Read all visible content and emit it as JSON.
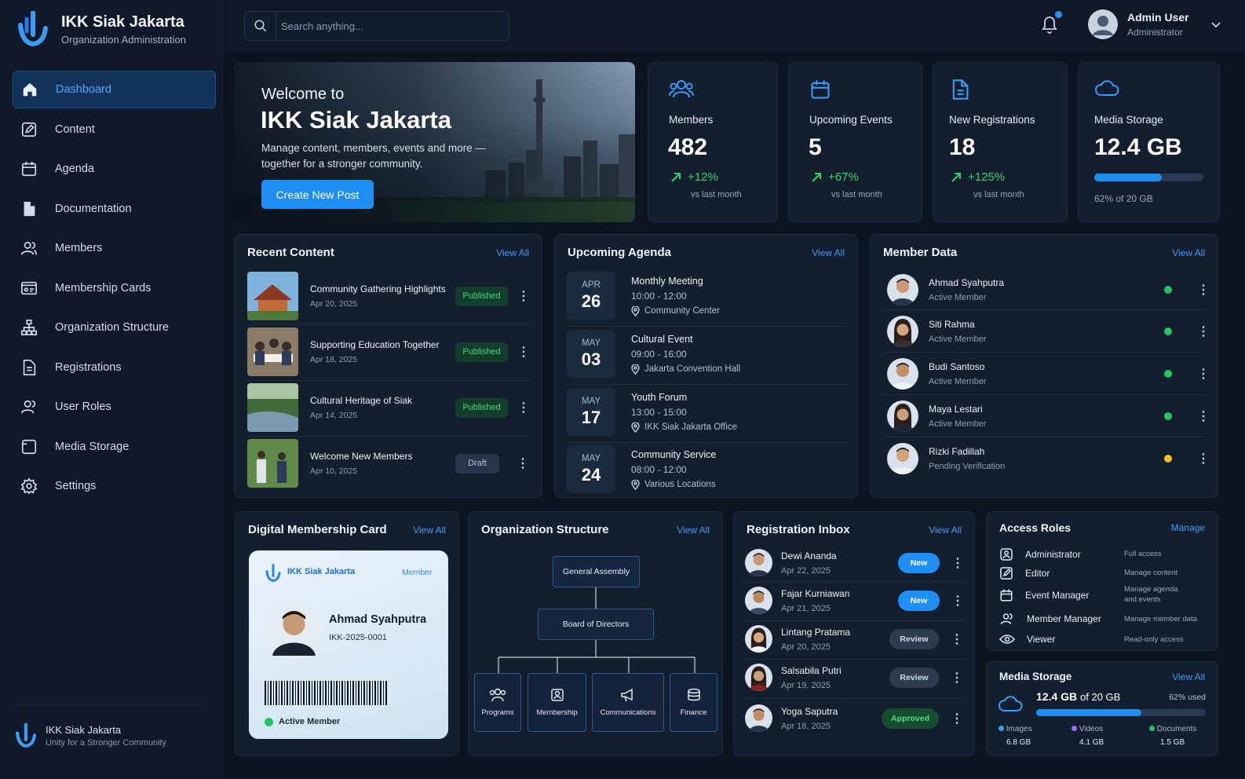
{
  "brand": {
    "name": "IKK Siak Jakarta",
    "subtitle": "Organization Administration"
  },
  "nav": [
    {
      "label": "Dashboard",
      "icon": "home-icon"
    },
    {
      "label": "Content",
      "icon": "edit-icon"
    },
    {
      "label": "Agenda",
      "icon": "calendar-icon"
    },
    {
      "label": "Documentation",
      "icon": "document-icon"
    },
    {
      "label": "Members",
      "icon": "users-icon"
    },
    {
      "label": "Membership Cards",
      "icon": "id-card-icon"
    },
    {
      "label": "Organization Structure",
      "icon": "hierarchy-icon"
    },
    {
      "label": "Registrations",
      "icon": "form-icon"
    },
    {
      "label": "User Roles",
      "icon": "user-roles-icon"
    },
    {
      "label": "Media Storage",
      "icon": "storage-icon"
    },
    {
      "label": "Settings",
      "icon": "gear-icon"
    }
  ],
  "footer": {
    "name": "IKK Siak Jakarta",
    "tagline": "Unity for a Stronger Community"
  },
  "search": {
    "placeholder": "Search anything..."
  },
  "user": {
    "name": "Admin User",
    "role": "Administrator"
  },
  "hero": {
    "welcome": "Welcome to",
    "title": "IKK Siak Jakarta",
    "description": "Manage content, members, events and more — together for a stronger community.",
    "button": "Create New Post"
  },
  "stats": [
    {
      "label": "Members",
      "value": "482",
      "trend": "+12%",
      "sub": "vs last month",
      "icon": "users-icon"
    },
    {
      "label": "Upcoming Events",
      "value": "5",
      "trend": "+67%",
      "sub": "vs last month",
      "icon": "calendar-icon"
    },
    {
      "label": "New Registrations",
      "value": "18",
      "trend": "+125%",
      "sub": "vs last month",
      "icon": "document-icon"
    },
    {
      "label": "Media Storage",
      "value": "12.4 GB",
      "progress": 0.62,
      "sub": "62% of 20 GB",
      "icon": "cloud-icon"
    }
  ],
  "recent": {
    "title": "Recent Content",
    "view_all": "View All",
    "items": [
      {
        "title": "Community Gathering Highlights",
        "date": "Apr 20, 2025",
        "status": "Published"
      },
      {
        "title": "Supporting Education Together",
        "date": "Apr 18, 2025",
        "status": "Published"
      },
      {
        "title": "Cultural Heritage of Siak",
        "date": "Apr 14, 2025",
        "status": "Published"
      },
      {
        "title": "Welcome New Members",
        "date": "Apr 10, 2025",
        "status": "Draft"
      }
    ]
  },
  "agenda": {
    "title": "Upcoming Agenda",
    "view_all": "View All",
    "items": [
      {
        "month": "APR",
        "day": "26",
        "title": "Monthly Meeting",
        "time": "10:00 - 12:00",
        "location": "Community Center"
      },
      {
        "month": "MAY",
        "day": "03",
        "title": "Cultural Event",
        "time": "09:00 - 16:00",
        "location": "Jakarta Convention Hall"
      },
      {
        "month": "MAY",
        "day": "17",
        "title": "Youth Forum",
        "time": "13:00 - 15:00",
        "location": "IKK Siak Jakarta Office"
      },
      {
        "month": "MAY",
        "day": "24",
        "title": "Community Service",
        "time": "08:00 - 12:00",
        "location": "Various Locations"
      }
    ]
  },
  "member_data": {
    "title": "Member Data",
    "view_all": "View All",
    "items": [
      {
        "name": "Ahmad Syahputra",
        "status": "Active Member",
        "color": "#22c55e"
      },
      {
        "name": "Siti Rahma",
        "status": "Active Member",
        "color": "#22c55e"
      },
      {
        "name": "Budi Santoso",
        "status": "Active Member",
        "color": "#22c55e"
      },
      {
        "name": "Maya Lestari",
        "status": "Active Member",
        "color": "#22c55e"
      },
      {
        "name": "Rizki Fadillah",
        "status": "Pending Verification",
        "color": "#fbbf24"
      }
    ]
  },
  "card": {
    "title": "Digital Membership Card",
    "view_all": "View All",
    "org": "IKK Siak Jakarta",
    "type": "Member",
    "name": "Ahmad Syahputra",
    "id": "IKK-2025-0001",
    "status": "Active Member"
  },
  "org": {
    "title": "Organization Structure",
    "view_all": "View All",
    "top": "General Assembly",
    "board": "Board of Directors",
    "divisions": [
      {
        "label": "Programs",
        "icon": "people-icon"
      },
      {
        "label": "Membership",
        "icon": "id-badge-icon"
      },
      {
        "label": "Communications",
        "icon": "megaphone-icon"
      },
      {
        "label": "Finance",
        "icon": "coins-icon"
      }
    ]
  },
  "inbox": {
    "title": "Registration Inbox",
    "view_all": "View All",
    "items": [
      {
        "name": "Dewi Ananda",
        "date": "Apr 22, 2025",
        "status": "New"
      },
      {
        "name": "Fajar Kurniawan",
        "date": "Apr 21, 2025",
        "status": "New"
      },
      {
        "name": "Lintang Pratama",
        "date": "Apr 20, 2025",
        "status": "Review"
      },
      {
        "name": "Salsabila Putri",
        "date": "Apr 19, 2025",
        "status": "Review"
      },
      {
        "name": "Yoga Saputra",
        "date": "Apr 18, 2025",
        "status": "Approved"
      }
    ]
  },
  "roles": {
    "title": "Access Roles",
    "manage": "Manage",
    "items": [
      {
        "name": "Administrator",
        "desc": "Full access",
        "icon": "admin-icon"
      },
      {
        "name": "Editor",
        "desc": "Manage content",
        "icon": "pencil-icon"
      },
      {
        "name": "Event Manager",
        "desc": "Manage agenda and events",
        "icon": "calendar-icon"
      },
      {
        "name": "Member Manager",
        "desc": "Manage member data",
        "icon": "users-icon"
      },
      {
        "name": "Viewer",
        "desc": "Read-only access",
        "icon": "eye-icon"
      }
    ]
  },
  "storage": {
    "title": "Media Storage",
    "view_all": "View All",
    "used": "12.4 GB",
    "of": "of 20 GB",
    "percent_label": "62% used",
    "progress": 0.62,
    "breakdown": [
      {
        "label": "Images",
        "value": "6.8 GB",
        "color": "#3b9bf5"
      },
      {
        "label": "Videos",
        "value": "4.1 GB",
        "color": "#9b6cf0"
      },
      {
        "label": "Documents",
        "value": "1.5 GB",
        "color": "#22c55e"
      }
    ]
  }
}
